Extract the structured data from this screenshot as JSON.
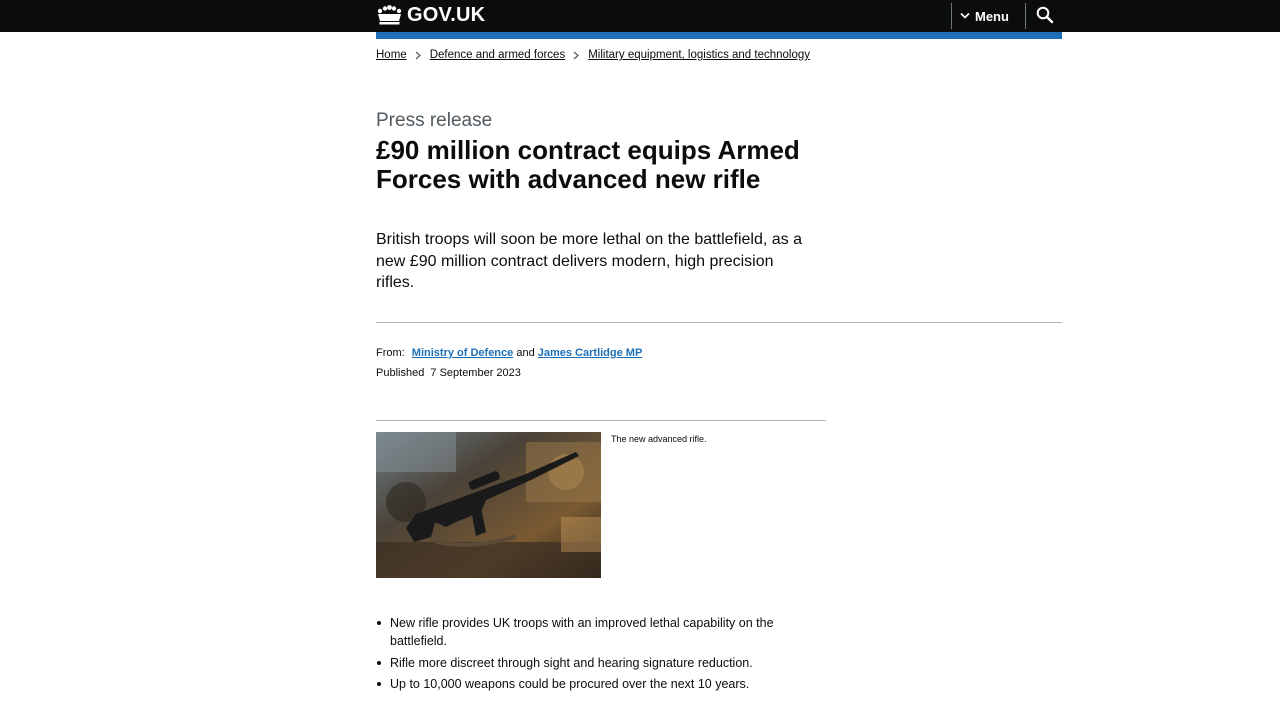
{
  "header": {
    "logo_text": "GOV.UK",
    "menu_label": "Menu",
    "colors": {
      "background": "#0b0c0c",
      "accent_bar": "#1d70b8"
    }
  },
  "breadcrumbs": [
    {
      "label": "Home"
    },
    {
      "label": "Defence and armed forces"
    },
    {
      "label": "Military equipment, logistics and technology"
    }
  ],
  "article": {
    "type_label": "Press release",
    "title": "£90 million contract equips Armed Forces with advanced new rifle",
    "lead": "British troops will soon be more lethal on the battlefield, as a new £90 million contract delivers modern, high precision rifles.",
    "from_label": "From:",
    "organisations": [
      "Ministry of Defence",
      "James Cartlidge MP"
    ],
    "and_text": "and",
    "published_label": "Published",
    "published_date": "7 September 2023",
    "image_caption": "The new advanced rifle.",
    "bullets": [
      "New rifle provides UK troops with an improved lethal capability on the battlefield.",
      "Rifle more discreet through sight and hearing signature reduction.",
      "Up to 10,000 weapons could be procured over the next 10 years."
    ]
  },
  "icons": {
    "logo": "crown-icon",
    "menu": "chevron-down-icon",
    "search": "search-icon",
    "breadcrumb_separator": "chevron-right-icon"
  }
}
